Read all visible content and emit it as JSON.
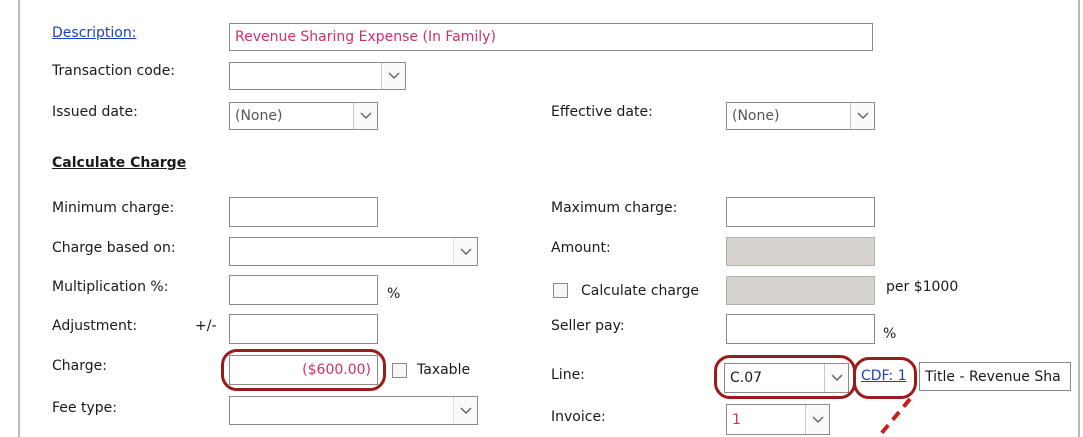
{
  "form": {
    "description_label": "Description:",
    "description_value": "Revenue Sharing Expense (In Family)",
    "transaction_code_label": "Transaction code:",
    "transaction_code_value": "",
    "issued_date_label": "Issued date:",
    "issued_date_value": "(None)",
    "effective_date_label": "Effective date:",
    "effective_date_value": "(None)"
  },
  "calculate_charge": {
    "heading": "Calculate Charge",
    "minimum_charge_label": "Minimum charge:",
    "minimum_charge_value": "",
    "maximum_charge_label": "Maximum charge:",
    "maximum_charge_value": "",
    "charge_based_on_label": "Charge based on:",
    "charge_based_on_value": "",
    "amount_label": "Amount:",
    "multiplication_label": "Multiplication %:",
    "multiplication_value": "",
    "percent_symbol": "%",
    "calculate_charge_checkbox_label": "Calculate charge",
    "per_1000_label": "per $1000",
    "adjustment_label": "Adjustment:",
    "adjustment_sign": "+/-",
    "adjustment_value": "",
    "seller_pay_label": "Seller pay:",
    "seller_pay_value": "",
    "seller_pay_percent": "%",
    "charge_label": "Charge:",
    "charge_value": "($600.00)",
    "taxable_label": "Taxable",
    "line_label": "Line:",
    "line_value": "C.07",
    "cdf_link": "CDF: 1",
    "cdf_title_value": "Title - Revenue Sha",
    "fee_type_label": "Fee type:",
    "fee_type_value": "",
    "invoice_label": "Invoice:",
    "invoice_value": "1"
  },
  "icons": {
    "dropdown": "chevron-down-icon",
    "checkbox": "checkbox-unchecked-icon"
  },
  "colors": {
    "link": "#1f3fbf",
    "highlight_ring": "#9b1b1b",
    "value_text": "#d0306a",
    "readonly_field": "#d5d1cc"
  }
}
